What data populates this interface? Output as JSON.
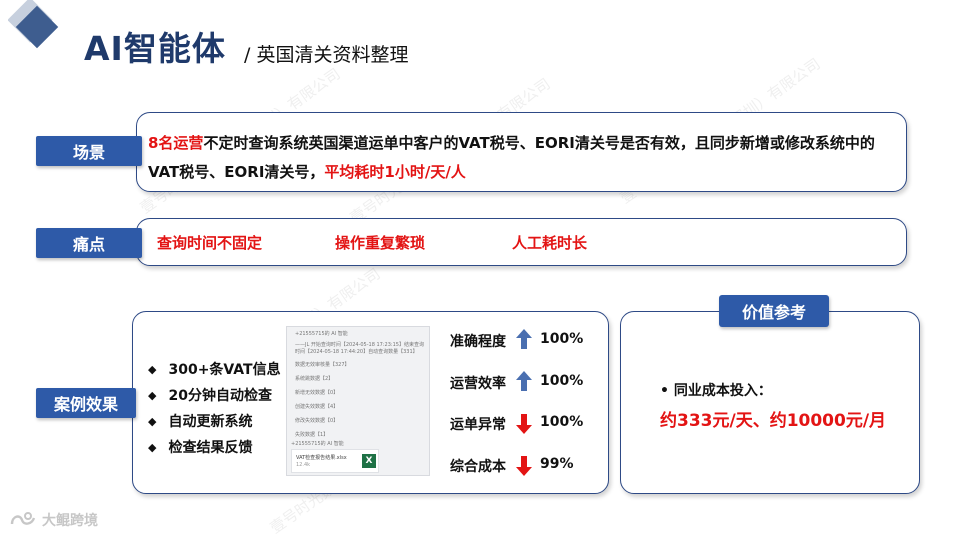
{
  "header": {
    "title": "AI智能体",
    "subtitle": "/ 英国清关资料整理"
  },
  "scene": {
    "label": "场景",
    "text_parts": [
      {
        "text": "8名运营",
        "highlight": true
      },
      {
        "text": "不定时查询系统英国渠道运单中客户的VAT税号、EORI清关号是否有效，且同步新增或修改系统中的VAT税号、EORI清关号，",
        "highlight": false
      },
      {
        "text": "平均耗时1小时/天/人",
        "highlight": true
      }
    ]
  },
  "pain": {
    "label": "痛点",
    "items": [
      "查询时间不固定",
      "操作重复繁琐",
      "人工耗时长"
    ]
  },
  "case": {
    "label": "案例效果",
    "bullets": [
      "300+条VAT信息",
      "20分钟自动检查",
      "自动更新系统",
      "检查结果反馈"
    ],
    "metrics": [
      {
        "label": "准确程度",
        "direction": "up",
        "value": "100%"
      },
      {
        "label": "运营效率",
        "direction": "up",
        "value": "100%"
      },
      {
        "label": "运单异常",
        "direction": "down",
        "value": "100%"
      },
      {
        "label": "综合成本",
        "direction": "down",
        "value": "99%"
      }
    ],
    "screenshot": {
      "header_line_1": "+21555715的 AI 智能",
      "msg_line_1": "——JL 开始查询时间【2024-05-18 17:23:15】结束查询",
      "msg_line_2": "时间【2024-05-18 17:44:20】自动查询数量【331】",
      "rows": [
        "数据无效审核量【327】",
        "系统跳数据【2】",
        "新增无效数据【0】",
        "创建失效数据【4】",
        "修改失效数据【0】",
        "失败数据【1】"
      ],
      "header_line_2": "+21555715的 AI 智能",
      "file_name": "VAT检查报告结果.xlsx",
      "file_size": "12.4k",
      "file_icon": "X"
    }
  },
  "value": {
    "label": "价值参考",
    "cost_label": "• 同业成本投入：",
    "cost_value": "约333元/天、约10000元/月"
  },
  "watermark": {
    "text": "壹号时光数字科技（深圳）有限公司"
  },
  "logo": {
    "text": "大鲲跨境"
  },
  "colors": {
    "accent": "#2e5aa8",
    "title": "#1f3a6b",
    "highlight": "#e31414",
    "arrow_up": "#4a6fb0",
    "arrow_down": "#e31414"
  }
}
